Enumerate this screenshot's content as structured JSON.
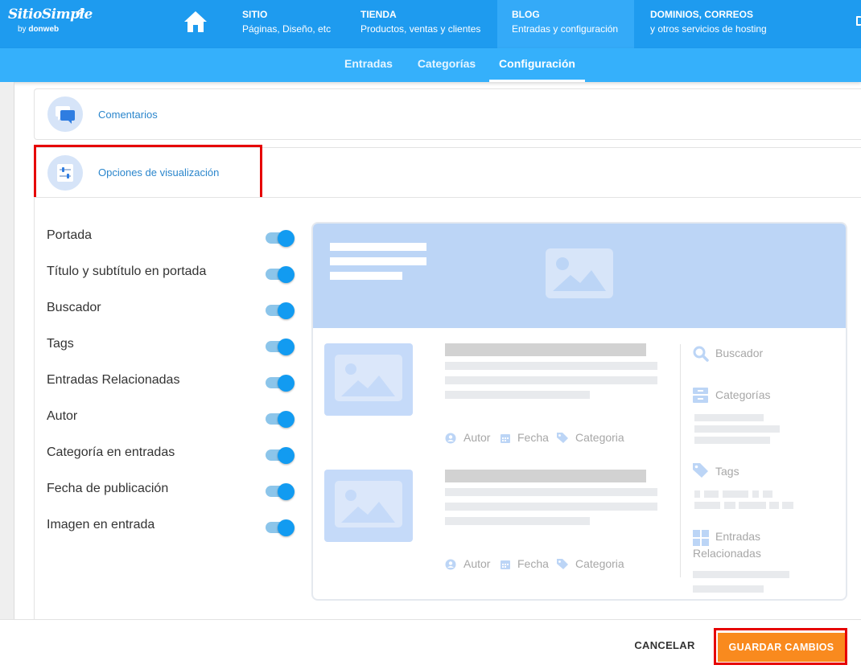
{
  "brand": {
    "name": "SitioSimple",
    "by": "by",
    "company": "donweb"
  },
  "top_nav": [
    {
      "title": "SITIO",
      "subtitle": "Páginas, Diseño, etc"
    },
    {
      "title": "TIENDA",
      "subtitle": "Productos, ventas y clientes"
    },
    {
      "title": "BLOG",
      "subtitle": "Entradas y configuración"
    },
    {
      "title": "DOMINIOS, CORREOS",
      "subtitle": "y otros servicios de hosting"
    }
  ],
  "sub_nav": {
    "tabs": [
      "Entradas",
      "Categorías",
      "Configuración"
    ],
    "active": "Configuración"
  },
  "sections": [
    {
      "label": "Comentarios",
      "icon": "comment-bubbles-icon"
    },
    {
      "label": "Opciones de visualización",
      "icon": "sliders-icon"
    }
  ],
  "toggles": [
    {
      "label": "Portada",
      "on": true
    },
    {
      "label": "Título y subtítulo en portada",
      "on": true
    },
    {
      "label": "Buscador",
      "on": true
    },
    {
      "label": "Tags",
      "on": true
    },
    {
      "label": "Entradas Relacionadas",
      "on": true
    },
    {
      "label": "Autor",
      "on": true
    },
    {
      "label": "Categoría en entradas",
      "on": true
    },
    {
      "label": "Fecha de publicación",
      "on": true
    },
    {
      "label": "Imagen en entrada",
      "on": true
    }
  ],
  "preview": {
    "meta": {
      "author": "Autor",
      "date": "Fecha",
      "category": "Categoria"
    },
    "sidebar": {
      "search": "Buscador",
      "categories": "Categorías",
      "tags": "Tags",
      "related_1": "Entradas",
      "related_2": "Relacionadas"
    }
  },
  "footer": {
    "cancel": "CANCELAR",
    "save": "GUARDAR CAMBIOS"
  },
  "colors": {
    "primary": "#1e9bef",
    "subnav": "#35b0fb",
    "accent": "#f98a1e",
    "highlight": "#e60000",
    "toggle": "#129bf1"
  }
}
